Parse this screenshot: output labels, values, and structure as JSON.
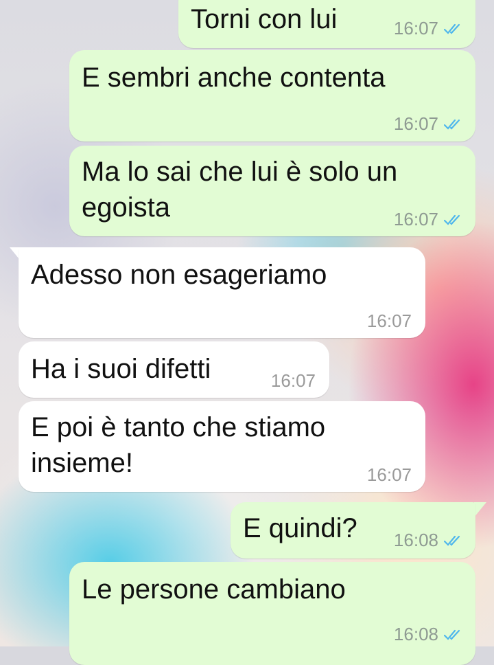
{
  "chat": {
    "messages": [
      {
        "direction": "out",
        "text": "Torni con lui",
        "time": "16:07",
        "status": "read-double-check-icon"
      },
      {
        "direction": "out",
        "text": "E sembri anche contenta",
        "time": "16:07",
        "status": "read-double-check-icon"
      },
      {
        "direction": "out",
        "text": "Ma lo sai che lui è solo un\negoista",
        "time": "16:07",
        "status": "read-double-check-icon"
      },
      {
        "direction": "in",
        "text": "Adesso non esageriamo",
        "time": "16:07"
      },
      {
        "direction": "in",
        "text": "Ha i suoi difetti",
        "time": "16:07"
      },
      {
        "direction": "in",
        "text": "E poi è tanto che stiamo\ninsieme!",
        "time": "16:07"
      },
      {
        "direction": "out",
        "text": "E quindi?",
        "time": "16:08",
        "status": "read-double-check-icon"
      },
      {
        "direction": "out",
        "text": "Le persone cambiano",
        "time": "16:08",
        "status": "read-double-check-icon"
      }
    ]
  },
  "colors": {
    "outgoing_bubble": "#e2fcd4",
    "incoming_bubble": "#ffffff",
    "read_ticks": "#4fb6ec"
  }
}
